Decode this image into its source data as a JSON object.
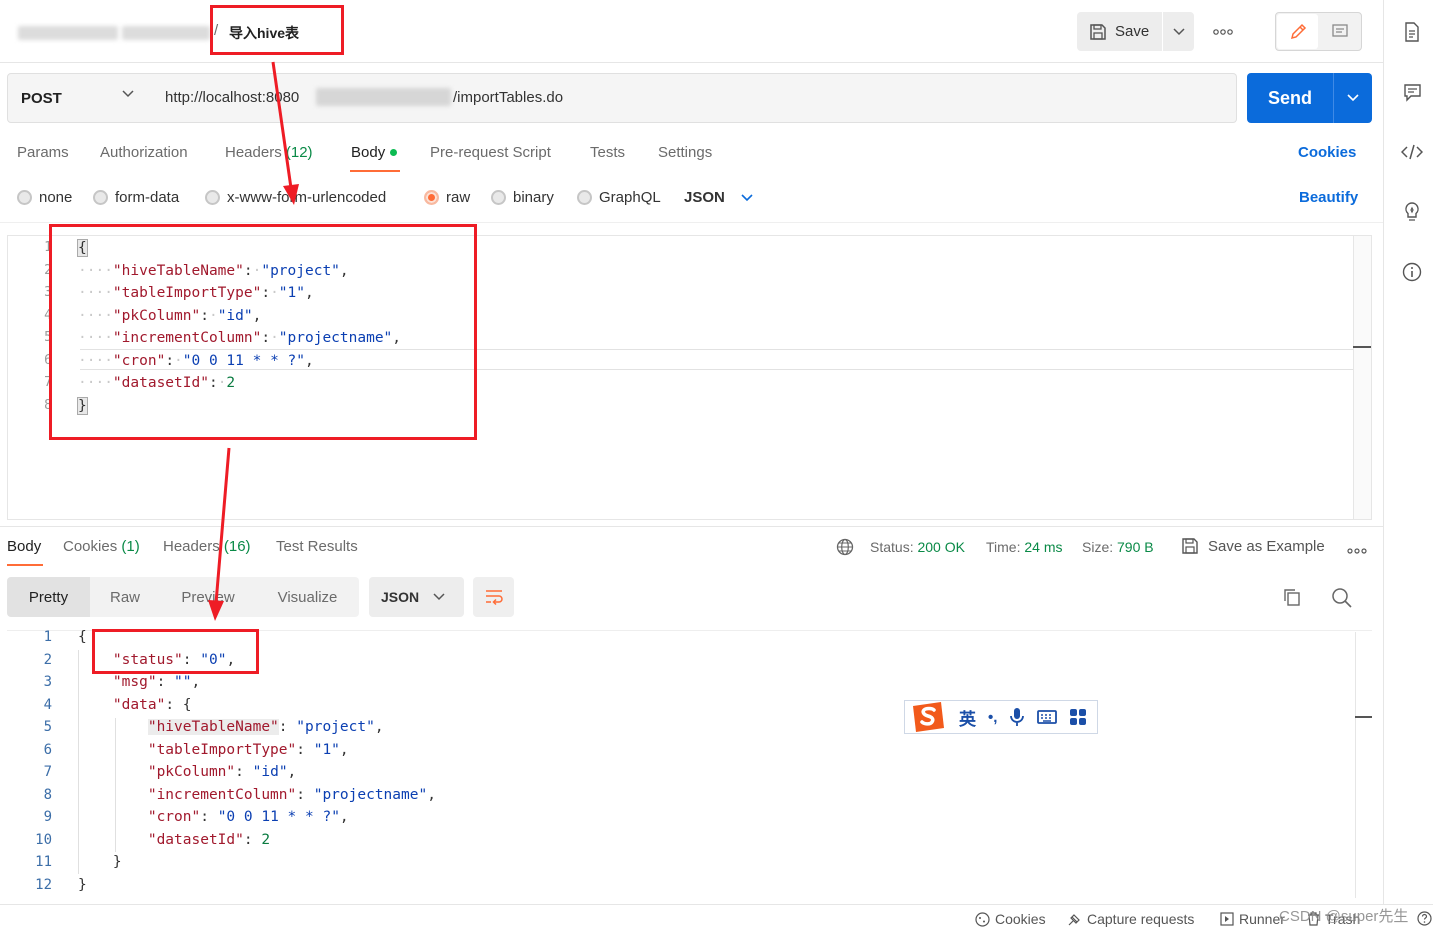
{
  "header": {
    "request_title": "导入hive表",
    "breadcrumb_sep": "/",
    "save_label": "Save"
  },
  "request": {
    "method": "POST",
    "url_prefix": "http://localhost:8080",
    "url_suffix": "/importTables.do",
    "send_label": "Send"
  },
  "tabs": {
    "params": "Params",
    "authorization": "Authorization",
    "headers": "Headers",
    "headers_count": "(12)",
    "body": "Body",
    "pre_request": "Pre-request Script",
    "tests": "Tests",
    "settings": "Settings",
    "cookies": "Cookies"
  },
  "body_types": {
    "none": "none",
    "form_data": "form-data",
    "urlencoded": "x-www-form-urlencoded",
    "raw": "raw",
    "binary": "binary",
    "graphql": "GraphQL",
    "format": "JSON",
    "beautify": "Beautify"
  },
  "request_body": {
    "line_numbers": [
      "1",
      "2",
      "3",
      "4",
      "5",
      "6",
      "7",
      "8"
    ],
    "open": "{",
    "close": "}",
    "k1": "\"hiveTableName\"",
    "v1": "\"project\"",
    "k2": "\"tableImportType\"",
    "v2": "\"1\"",
    "k3": "\"pkColumn\"",
    "v3": "\"id\"",
    "k4": "\"incrementColumn\"",
    "v4": "\"projectname\"",
    "k5": "\"cron\"",
    "v5": "\"0 0 11 * * ?\"",
    "k6": "\"datasetId\"",
    "v6": "2"
  },
  "response_tabs": {
    "body": "Body",
    "cookies": "Cookies",
    "cookies_count": "(1)",
    "headers": "Headers",
    "headers_count": "(16)",
    "test_results": "Test Results"
  },
  "response_meta": {
    "status_label": "Status:",
    "status_value": "200 OK",
    "time_label": "Time:",
    "time_value": "24 ms",
    "size_label": "Size:",
    "size_value": "790 B",
    "save_example": "Save as Example"
  },
  "view_modes": {
    "pretty": "Pretty",
    "raw": "Raw",
    "preview": "Preview",
    "visualize": "Visualize",
    "format": "JSON"
  },
  "response_body": {
    "line_numbers": [
      "1",
      "2",
      "3",
      "4",
      "5",
      "6",
      "7",
      "8",
      "9",
      "10",
      "11",
      "12"
    ],
    "open": "{",
    "close": "}",
    "status_k": "\"status\"",
    "status_v": "\"0\"",
    "msg_k": "\"msg\"",
    "msg_v": "\"\"",
    "data_k": "\"data\"",
    "k1": "\"hiveTableName\"",
    "v1": "\"project\"",
    "k2": "\"tableImportType\"",
    "v2": "\"1\"",
    "k3": "\"pkColumn\"",
    "v3": "\"id\"",
    "k4": "\"incrementColumn\"",
    "v4": "\"projectname\"",
    "k5": "\"cron\"",
    "v5": "\"0 0 11 * * ?\"",
    "k6": "\"datasetId\"",
    "v6": "2"
  },
  "ime": {
    "lang": "英",
    "punct": "•,"
  },
  "footer": {
    "cookies": "Cookies",
    "capture": "Capture requests",
    "runner": "Runner",
    "trash": "Trash",
    "watermark": "CSDN @super先生"
  },
  "colors": {
    "send_blue": "#0b6bdb",
    "accent_orange": "#ff6c37",
    "status_green": "#0a8a47",
    "annotation_red": "#ee1c25"
  }
}
